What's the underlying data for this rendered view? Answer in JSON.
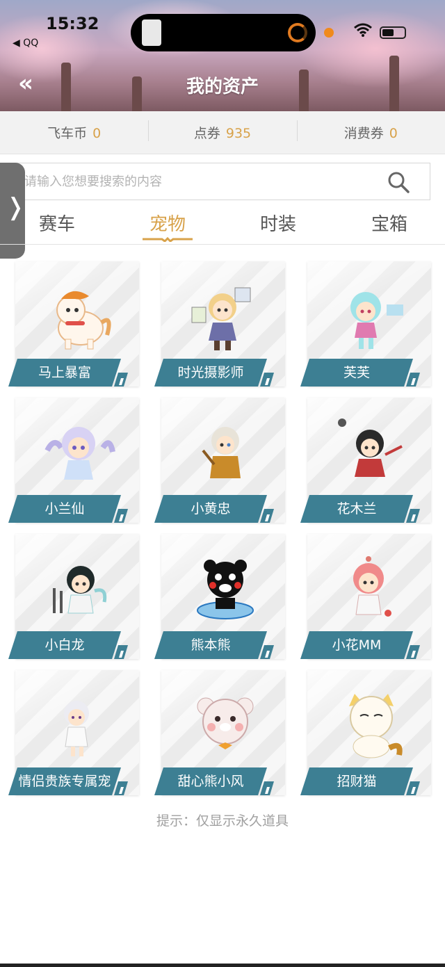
{
  "status_bar": {
    "time": "15:32",
    "back_app": "◀ QQ"
  },
  "header": {
    "title": "我的资产",
    "back_icon": "double-chevron-left-icon"
  },
  "currency": [
    {
      "label": "飞车币",
      "value": "0"
    },
    {
      "label": "点券",
      "value": "935"
    },
    {
      "label": "消费券",
      "value": "0"
    }
  ],
  "search": {
    "placeholder": "请输入您想要搜索的内容",
    "icon": "search-icon"
  },
  "tabs": [
    {
      "label": "赛车",
      "active": false
    },
    {
      "label": "宠物",
      "active": true
    },
    {
      "label": "时装",
      "active": false
    },
    {
      "label": "宝箱",
      "active": false
    }
  ],
  "pets": [
    {
      "name": "马上暴富"
    },
    {
      "name": "时光摄影师"
    },
    {
      "name": "芙芙"
    },
    {
      "name": "小兰仙"
    },
    {
      "name": "小黄忠"
    },
    {
      "name": "花木兰"
    },
    {
      "name": "小白龙"
    },
    {
      "name": "熊本熊"
    },
    {
      "name": "小花MM"
    },
    {
      "name": "情侣贵族专属宠"
    },
    {
      "name": "甜心熊小风"
    },
    {
      "name": "招财猫"
    }
  ],
  "hint": "提示：仅显示永久道具",
  "colors": {
    "accent": "#d8a24a",
    "label_bg": "#3d7f93"
  }
}
